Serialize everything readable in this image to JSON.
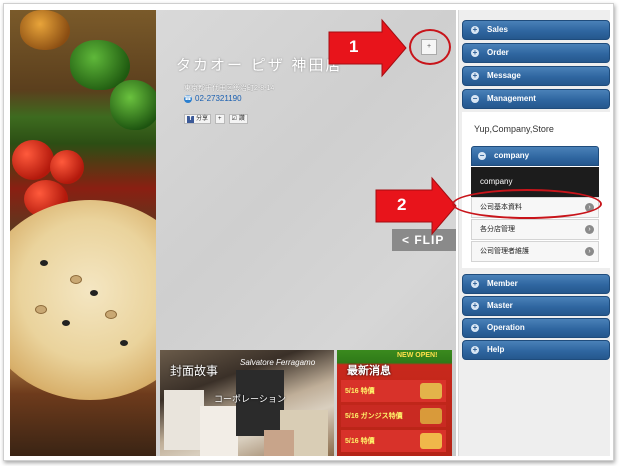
{
  "shop": {
    "title": "タカオー ピザ 神田店",
    "address": "東京都千代田区鍛冶町2-8-14",
    "phone": "02-27321190",
    "share": [
      "分享",
      "讚"
    ]
  },
  "flip_label": "< FLIP",
  "corner_button_label": "+",
  "thumbnails": {
    "left": {
      "title": "封面故事",
      "subtitle": "コーポレーション",
      "brand": "Salvatore Ferragamo"
    },
    "right": {
      "title": "最新消息",
      "banner": "NEW OPEN!",
      "labels": [
        "5/16 特價",
        "5/16 ガンジス特價",
        "5/16 特價"
      ]
    }
  },
  "sidebar": {
    "sections": [
      {
        "label": "Sales",
        "sign": "+"
      },
      {
        "label": "Order",
        "sign": "+"
      },
      {
        "label": "Message",
        "sign": "+"
      },
      {
        "label": "Management",
        "sign": "−"
      }
    ],
    "management": {
      "text": "Yup,Company,Store",
      "sub_header": {
        "label": "company",
        "sign": "−"
      },
      "company_label": "company",
      "items": [
        "公司基本資料",
        "各分店管理",
        "公司管理者維護"
      ]
    },
    "lower_sections": [
      {
        "label": "Member",
        "sign": "+"
      },
      {
        "label": "Master",
        "sign": "+"
      },
      {
        "label": "Operation",
        "sign": "+"
      },
      {
        "label": "Help",
        "sign": "+"
      }
    ]
  },
  "annotations": {
    "step1": "1",
    "step2": "2",
    "arrow_color": "#e8141b"
  }
}
